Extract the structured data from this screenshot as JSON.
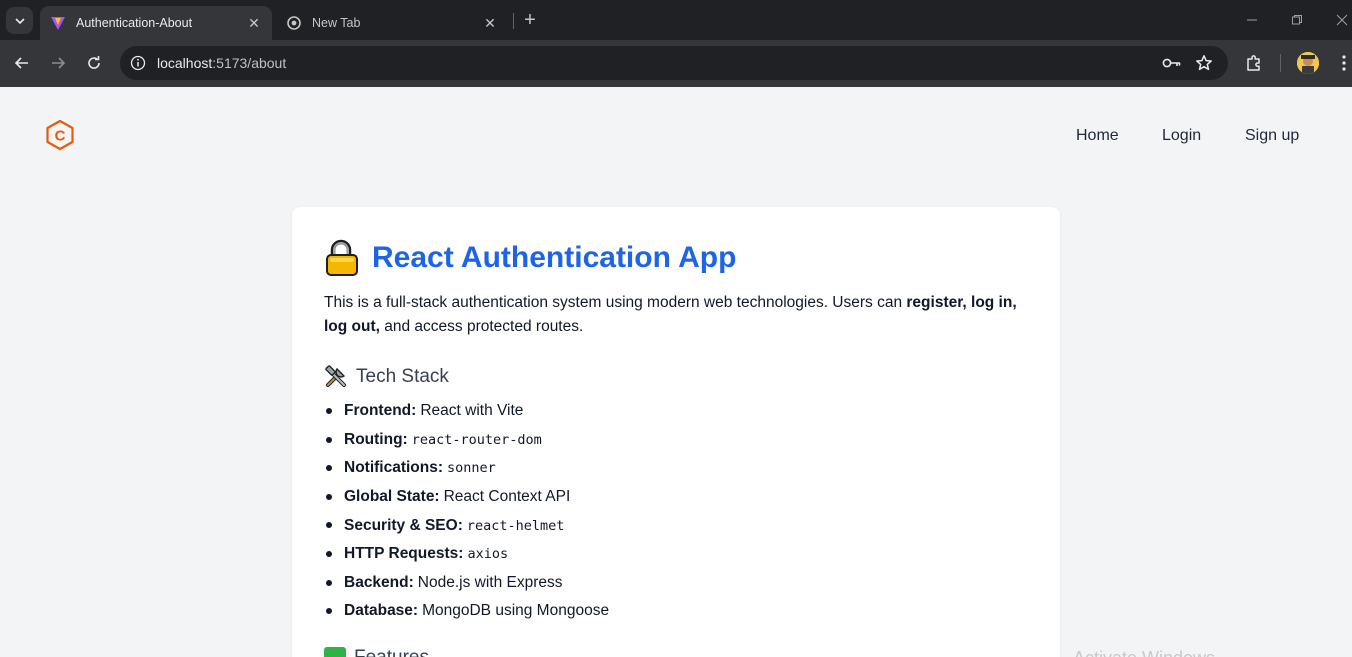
{
  "browser": {
    "tabs": [
      {
        "title": "Authentication-About",
        "active": true
      },
      {
        "title": "New Tab",
        "active": false
      }
    ],
    "url_host": "localhost",
    "url_rest": ":5173/about"
  },
  "site": {
    "logo_letter": "C",
    "nav": [
      "Home",
      "Login",
      "Sign up"
    ]
  },
  "about": {
    "title": "React Authentication App",
    "intro_prefix": "This is a full-stack authentication system using modern web technologies. Users can ",
    "intro_bold": "register, log in, log out,",
    "intro_suffix": " and access protected routes.",
    "tech_heading": "Tech Stack",
    "tech_stack": [
      {
        "key": "Frontend:",
        "value": "React with Vite",
        "code": false
      },
      {
        "key": "Routing:",
        "value": "react-router-dom",
        "code": true
      },
      {
        "key": "Notifications:",
        "value": "sonner",
        "code": true
      },
      {
        "key": "Global State:",
        "value": "React Context API",
        "code": false
      },
      {
        "key": "Security & SEO:",
        "value": "react-helmet",
        "code": true
      },
      {
        "key": "HTTP Requests:",
        "value": "axios",
        "code": true
      },
      {
        "key": "Backend:",
        "value": "Node.js with Express",
        "code": false
      },
      {
        "key": "Database:",
        "value": "MongoDB using Mongoose",
        "code": false
      }
    ],
    "next_heading": "Features"
  },
  "watermark": "Activate Windows",
  "colors": {
    "accent": "#1d64e8",
    "logo": "#e8590c"
  }
}
